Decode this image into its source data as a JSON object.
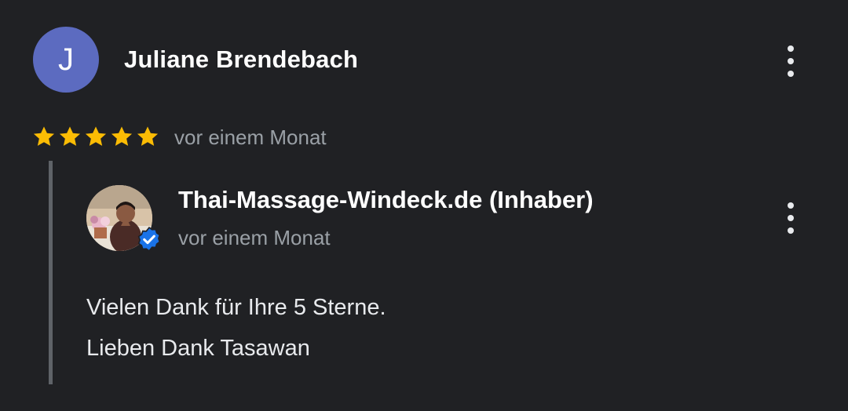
{
  "review": {
    "reviewer": {
      "initial": "J",
      "name": "Juliane Brendebach",
      "avatar_color": "#5c6bc0"
    },
    "rating": 5,
    "rating_max": 5,
    "time": "vor einem Monat",
    "menu_icon": "more-vert-icon"
  },
  "reply": {
    "owner_name": "Thai-Massage-Windeck.de",
    "owner_role": "(Inhaber)",
    "time": "vor einem Monat",
    "verified_icon": "verified-badge-icon",
    "lines": [
      "Vielen Dank für Ihre 5 Sterne.",
      "Lieben Dank Tasawan"
    ],
    "menu_icon": "more-vert-icon"
  },
  "colors": {
    "background": "#202124",
    "star": "#fbbc04",
    "secondary_text": "#9aa0a6",
    "verified": "#1a73e8"
  }
}
